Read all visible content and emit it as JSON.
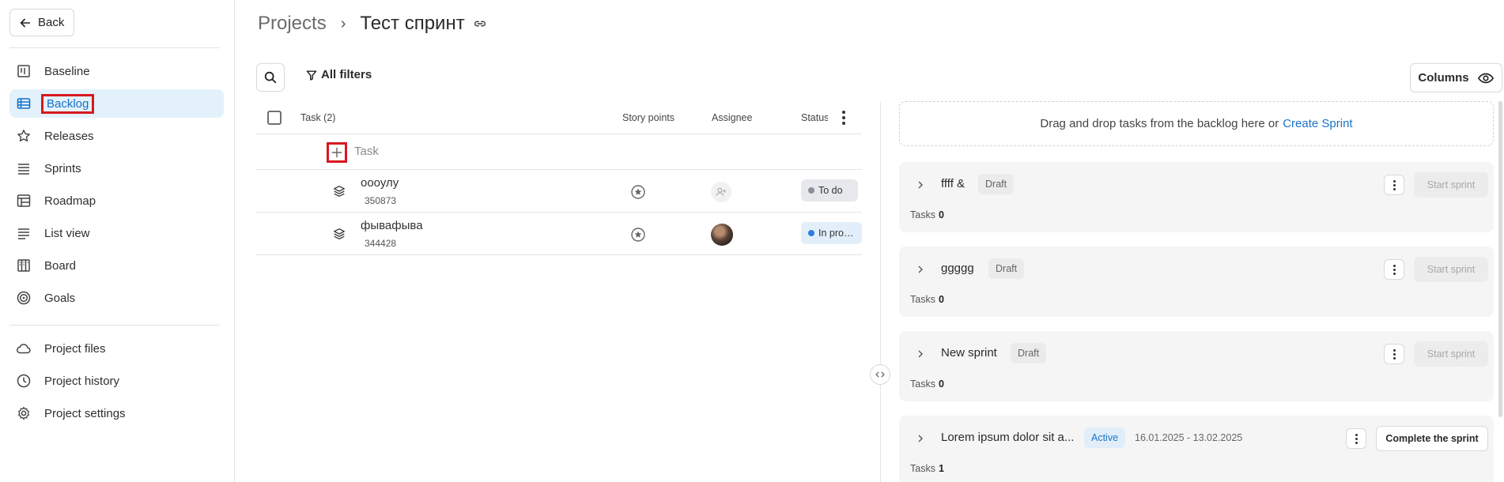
{
  "sidebar": {
    "back_label": "Back",
    "items": [
      {
        "label": "Baseline",
        "icon": "baseline-icon"
      },
      {
        "label": "Backlog",
        "icon": "backlog-icon",
        "active": true
      },
      {
        "label": "Releases",
        "icon": "star-icon"
      },
      {
        "label": "Sprints",
        "icon": "sprints-icon"
      },
      {
        "label": "Roadmap",
        "icon": "roadmap-icon"
      },
      {
        "label": "List view",
        "icon": "list-icon"
      },
      {
        "label": "Board",
        "icon": "board-icon"
      },
      {
        "label": "Goals",
        "icon": "target-icon"
      }
    ],
    "items2": [
      {
        "label": "Project files",
        "icon": "cloud-icon"
      },
      {
        "label": "Project history",
        "icon": "clock-icon"
      },
      {
        "label": "Project settings",
        "icon": "gear-icon"
      }
    ]
  },
  "header": {
    "breadcrumb_root": "Projects",
    "breadcrumb_sep": "›",
    "breadcrumb_current": "Тест спринт"
  },
  "toolbar": {
    "filters_label": "All filters",
    "columns_label": "Columns"
  },
  "table": {
    "headers": {
      "task": "Task (2)",
      "story_points": "Story points",
      "assignee": "Assignee",
      "status": "Status"
    },
    "add_task_label": "Task",
    "rows": [
      {
        "title": "оооулу",
        "id": "350873",
        "status": "To do",
        "status_color": "#8a8f98",
        "assignee": null
      },
      {
        "title": "фывафыва",
        "id": "344428",
        "status": "In pro…",
        "status_color": "#2f7de1",
        "assignee": "avatar"
      }
    ]
  },
  "sprints_panel": {
    "dropzone_text": "Drag and drop tasks from the backlog here or",
    "dropzone_link": "Create Sprint",
    "tasks_label": "Tasks",
    "start_label": "Start sprint",
    "complete_label": "Complete the sprint",
    "sprints": [
      {
        "name": "ffff &",
        "status": "Draft",
        "tasks": "0"
      },
      {
        "name": "ggggg",
        "status": "Draft",
        "tasks": "0"
      },
      {
        "name": "New sprint",
        "status": "Draft",
        "tasks": "0"
      },
      {
        "name": "Lorem ipsum dolor sit a...",
        "status": "Active",
        "dates": "16.01.2025 - 13.02.2025",
        "tasks": "1"
      }
    ]
  },
  "colors": {
    "accent": "#1a73c8",
    "active_bg": "#e3f1fb",
    "highlight": "#d7181f"
  }
}
